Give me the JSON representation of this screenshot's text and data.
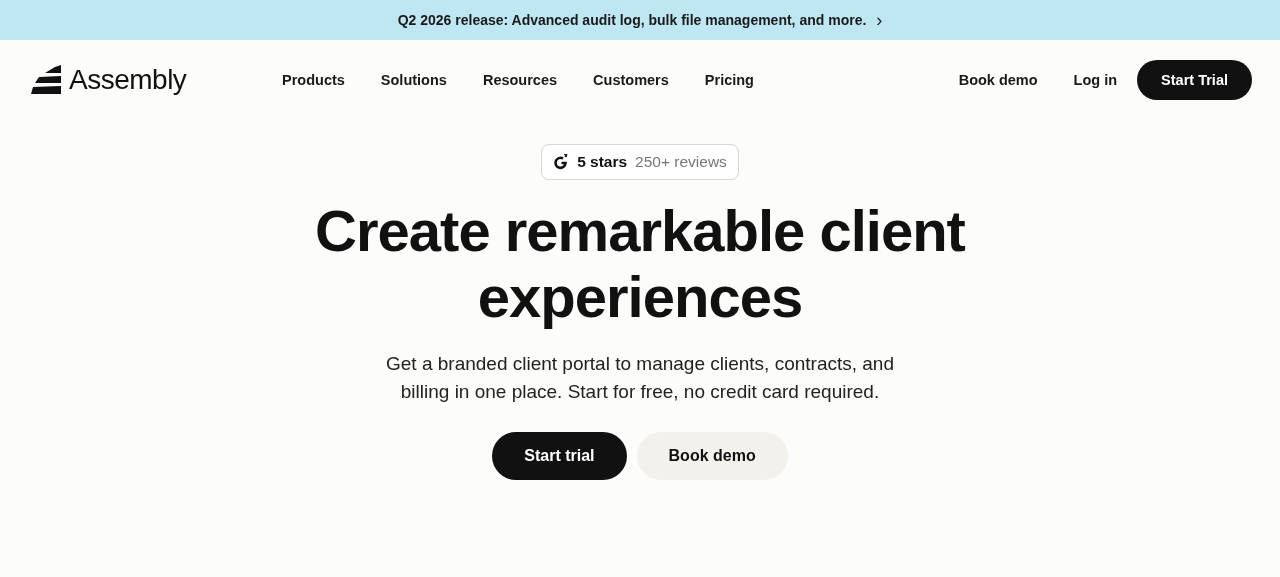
{
  "announcement": {
    "text": "Q2 2026 release: Advanced audit log, bulk file management, and more.",
    "icon": "›"
  },
  "nav": {
    "logo": "Assembly",
    "links": [
      "Products",
      "Solutions",
      "Resources",
      "Customers",
      "Pricing"
    ],
    "actions": [
      {
        "label": "Book demo",
        "kind": "link"
      },
      {
        "label": "Log in",
        "kind": "link"
      },
      {
        "label": "Start Trial",
        "kind": "primary"
      }
    ]
  },
  "rating": {
    "stars_text": "5 stars",
    "reviews": "250+ reviews"
  },
  "hero": {
    "title": "Create remarkable client experiences",
    "subtitle": "Get a branded client portal to manage clients, contracts, and billing in one place. Start for free, no credit card required.",
    "buttons": [
      {
        "label": "Start trial",
        "kind": "primary"
      },
      {
        "label": "Book demo",
        "kind": "secondary"
      }
    ]
  }
}
